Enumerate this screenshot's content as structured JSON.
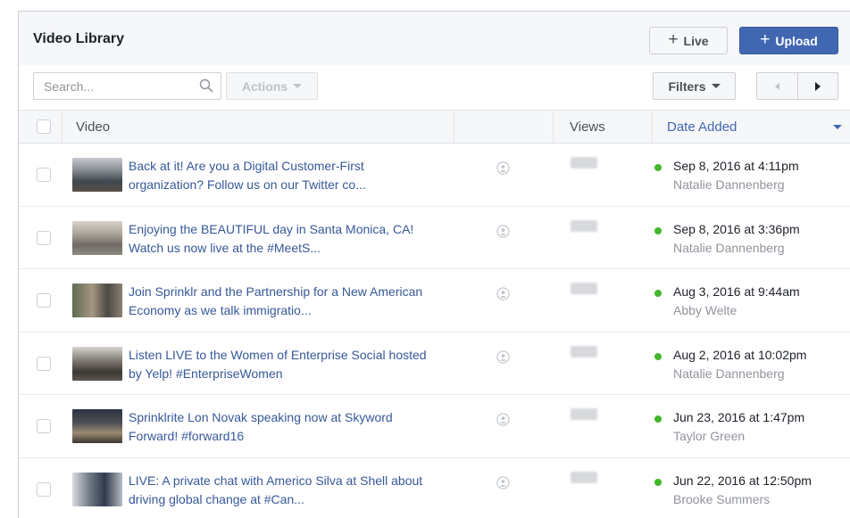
{
  "header": {
    "title": "Video Library",
    "live_label": "Live",
    "upload_label": "Upload"
  },
  "toolbar": {
    "search_placeholder": "Search...",
    "actions_label": "Actions",
    "filters_label": "Filters"
  },
  "table": {
    "columns": {
      "video": "Video",
      "views": "Views",
      "date_added": "Date Added"
    },
    "rows": [
      {
        "title": "Back at it! Are you a Digital Customer-First organization? Follow us on our Twitter co...",
        "date": "Sep 8, 2016 at 4:11pm",
        "author": "Natalie Dannenberg"
      },
      {
        "title": "Enjoying the BEAUTIFUL day in Santa Monica, CA! Watch us now live at the #MeetS...",
        "date": "Sep 8, 2016 at 3:36pm",
        "author": "Natalie Dannenberg"
      },
      {
        "title": "Join Sprinklr and the Partnership for a New American Economy as we talk immigratio...",
        "date": "Aug 3, 2016 at 9:44am",
        "author": "Abby Welte"
      },
      {
        "title": "Listen LIVE to the Women of Enterprise Social hosted by Yelp! #EnterpriseWomen",
        "date": "Aug 2, 2016 at 10:02pm",
        "author": "Natalie Dannenberg"
      },
      {
        "title": "Sprinklrite Lon Novak speaking now at Skyword Forward! #forward16",
        "date": "Jun 23, 2016 at 1:47pm",
        "author": "Taylor Green"
      },
      {
        "title": "LIVE: A private chat with Americo Silva at Shell about driving global change at #Can...",
        "date": "Jun 22, 2016 at 12:50pm",
        "author": "Brooke Summers"
      }
    ]
  },
  "colors": {
    "link": "#365899",
    "primary_button": "#4267b2",
    "live_dot": "#42b72a",
    "header_bg": "#f6f7f9"
  }
}
